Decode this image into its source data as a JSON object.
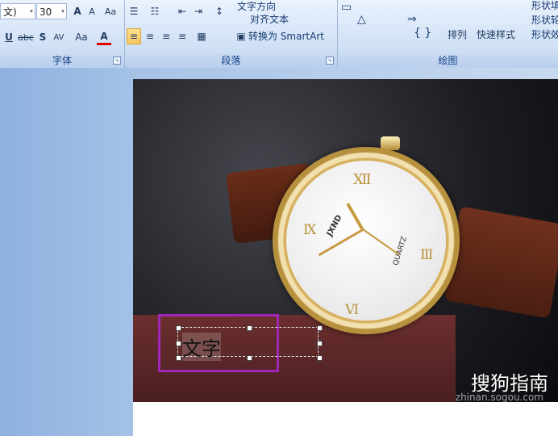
{
  "ribbon": {
    "font_group": {
      "label": "字体",
      "font_name": "文)",
      "font_size": "30",
      "buttons": {
        "grow": "A",
        "shrink": "A",
        "clear": "Aa",
        "underline": "U",
        "strikethrough": "abc",
        "shadow": "S",
        "spacing": "AV",
        "change_case": "Aa",
        "font_color": "A"
      }
    },
    "paragraph_group": {
      "label": "段落",
      "text_direction": "文字方向",
      "align_text": "对齐文本",
      "smartart": "转换为 SmartArt"
    },
    "drawing_group": {
      "label": "绘图",
      "arrange": "排列",
      "quick_styles": "快速样式",
      "shape_fill": "形状填",
      "shape_outline": "形状轮",
      "shape_effects": "形状效"
    }
  },
  "slide": {
    "text": "文字"
  },
  "watch": {
    "brand": "JXND",
    "quartz": "QUARTZ",
    "numerals": [
      "Ⅻ",
      "Ⅲ",
      "Ⅵ",
      "Ⅸ"
    ]
  },
  "watermark": {
    "logo": "搜狗指南",
    "url": "zhinan.sogou.com"
  }
}
